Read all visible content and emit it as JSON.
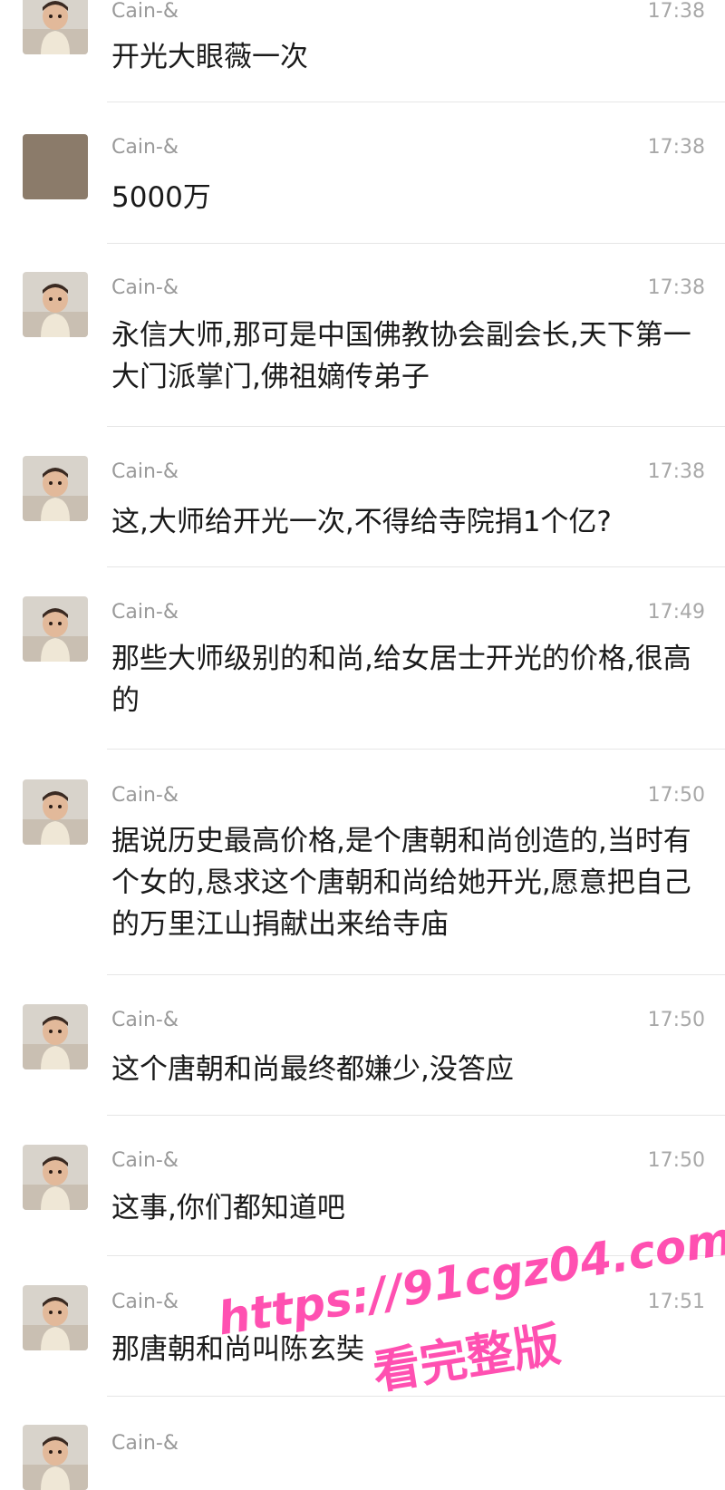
{
  "messages": [
    {
      "sender": "Cain-&",
      "time": "17:38",
      "text": "开光大眼薇一次",
      "avatar": "baby-photo"
    },
    {
      "sender": "Cain-&",
      "time": "17:38",
      "text": "5000万",
      "avatar": "plain-brown"
    },
    {
      "sender": "Cain-&",
      "time": "17:38",
      "text": "永信大师,那可是中国佛教协会副会长,天下第一大门派掌门,佛祖嫡传弟子",
      "avatar": "baby-photo"
    },
    {
      "sender": "Cain-&",
      "time": "17:38",
      "text": "这,大师给开光一次,不得给寺院捐1个亿?",
      "avatar": "baby-photo"
    },
    {
      "sender": "Cain-&",
      "time": "17:49",
      "text": "那些大师级别的和尚,给女居士开光的价格,很高的",
      "avatar": "baby-photo"
    },
    {
      "sender": "Cain-&",
      "time": "17:50",
      "text": "据说历史最高价格,是个唐朝和尚创造的,当时有个女的,恳求这个唐朝和尚给她开光,愿意把自己的万里江山捐献出来给寺庙",
      "avatar": "baby-photo"
    },
    {
      "sender": "Cain-&",
      "time": "17:50",
      "text": "这个唐朝和尚最终都嫌少,没答应",
      "avatar": "baby-photo"
    },
    {
      "sender": "Cain-&",
      "time": "17:50",
      "text": "这事,你们都知道吧",
      "avatar": "baby-photo"
    },
    {
      "sender": "Cain-&",
      "time": "17:51",
      "text": "那唐朝和尚叫陈玄奘",
      "avatar": "baby-photo"
    },
    {
      "sender": "Cain-&",
      "time": "",
      "text": "",
      "avatar": "baby-photo"
    }
  ],
  "watermark": {
    "url": "https://91cgz04.com",
    "caption": "看完整版",
    "color": "#ff3da8"
  }
}
